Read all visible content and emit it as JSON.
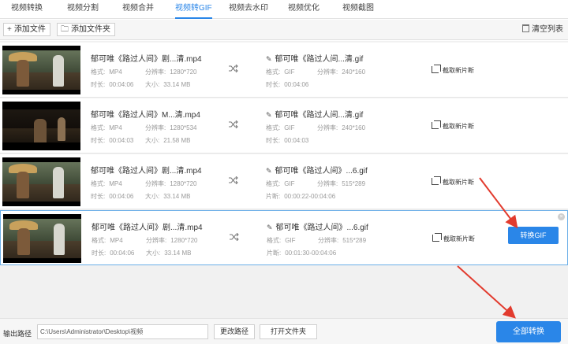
{
  "tabs": [
    {
      "label": "视频转换"
    },
    {
      "label": "视频分割"
    },
    {
      "label": "视频合并"
    },
    {
      "label": "视频转GIF"
    },
    {
      "label": "视频去水印"
    },
    {
      "label": "视频优化"
    },
    {
      "label": "视频截图"
    }
  ],
  "toolbar": {
    "add_file": "添加文件",
    "add_folder": "添加文件夹",
    "clear_list": "清空列表"
  },
  "labels": {
    "format": "格式:",
    "resolution": "分辨率:",
    "duration": "时长:",
    "size": "大小:",
    "segment": "片断:",
    "clip_new": "截取新片断"
  },
  "rows": [
    {
      "name": "郁可唯《路过人间》剧...清.mp4",
      "format": "MP4",
      "resolution": "1280*720",
      "duration": "00:04:06",
      "size": "33.14 MB",
      "out_name": "郁可唯《路过人间...清.gif",
      "out_format": "GIF",
      "out_resolution": "240*160",
      "out_label": "时长:",
      "out_value": "00:04:06"
    },
    {
      "name": "郁可唯《路过人间》M...清.mp4",
      "format": "MP4",
      "resolution": "1280*534",
      "duration": "00:04:03",
      "size": "21.58 MB",
      "out_name": "郁可唯《路过人间...清.gif",
      "out_format": "GIF",
      "out_resolution": "240*160",
      "out_label": "时长:",
      "out_value": "00:04:03"
    },
    {
      "name": "郁可唯《路过人间》剧...清.mp4",
      "format": "MP4",
      "resolution": "1280*720",
      "duration": "00:04:06",
      "size": "33.14 MB",
      "out_name": "郁可唯《路过人间》...6.gif",
      "out_format": "GIF",
      "out_resolution": "515*289",
      "out_label": "片断:",
      "out_value": "00:00:22-00:04:06"
    },
    {
      "name": "郁可唯《路过人间》剧...清.mp4",
      "format": "MP4",
      "resolution": "1280*720",
      "duration": "00:04:06",
      "size": "33.14 MB",
      "out_name": "郁可唯《路过人间》...6.gif",
      "out_format": "GIF",
      "out_resolution": "515*289",
      "out_label": "片断:",
      "out_value": "00:01:30-00:04:06"
    }
  ],
  "row_action": {
    "convert_gif": "转换GIF"
  },
  "footer": {
    "output_label": "输出路径",
    "output_path": "C:\\Users\\Administrator\\Desktop\\视频",
    "change_path": "更改路径",
    "open_folder": "打开文件夹",
    "convert_all": "全部转换"
  },
  "colors": {
    "accent": "#2a86e8",
    "annotation_arrow": "#e23b2e"
  },
  "icons": [
    "plus-icon",
    "folder-icon",
    "trash-icon",
    "shuffle-icon",
    "pencil-icon",
    "crop-icon",
    "close-icon"
  ]
}
